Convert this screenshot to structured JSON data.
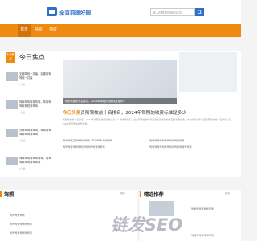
{
  "header": {
    "logo_text": "全百前途好园",
    "search_placeholder": "输入你想要搜索的内容",
    "colors": {
      "brand": "#2f6fcb",
      "accent": "#ef8a10"
    }
  },
  "nav": {
    "items": [
      "首页",
      "驾校",
      "驾校"
    ]
  },
  "hot": {
    "badge": "今日焦点",
    "title": "今日焦点",
    "list": [
      {
        "text": "无锡驾校一共最，杂锻驾驾驾校一共最",
        "date": "7天前"
      },
      {
        "text": "驾驾驾驾驾校驾驾，驾驾驾驾驾驾校驾驾驾",
        "date": "7天前"
      },
      {
        "text": "分驾驾驾驾驾驾，驾驾驾驾驾驾驾驾驾驾驾",
        "date": "7天前"
      },
      {
        "text": "驾驾驾驾驾驾驾驾驾，驾驾驾驾驾驾驾驾驾驾",
        "date": "7天前"
      }
    ]
  },
  "featured": {
    "caption": "贵阳驾校前十名排名，2024年驾照的收费标准是多少",
    "headline_highlight": "今日头条",
    "headline_text": "贵阳驾校前十名排名，2024年驾照的收费标准是多少",
    "summary": "贵阳驾校前十名排名，2024年驾照的收费标准是多少？驾校学员们，在选择驾校的时候都会关注驾校的排名和收费标准，本文将为大家介绍贵阳驾校前十名排名以及2024年驾照的收费标准。",
    "links_left": [
      "驾驾驾驾工驾驾驾驾驾驾 7825888 驾驾驾驾",
      "驾驾驾驾驾驾驾驾驾驾驾驾驾驾驾驾驾"
    ],
    "links_right": [
      "驾驾驾驾驾驾驾驾驾驾驾驾驾驾",
      "驾驾驾驾驾驾驾驾驾驾驾驾驾驾驾驾驾"
    ]
  },
  "sections": {
    "left": {
      "title": "驾照",
      "more": "更多",
      "items": [
        "驾驾驾驾驾驾",
        "驾驾驾驾驾驾驾驾驾",
        "驾驾驾驾驾驾驾驾驾"
      ]
    },
    "right": {
      "title": "精选推荐",
      "more": "更多",
      "items": [
        "驾驾驾驾驾驾驾驾驾",
        "驾驾驾驾驾驾驾驾驾"
      ]
    }
  },
  "watermark": "链发SEO"
}
